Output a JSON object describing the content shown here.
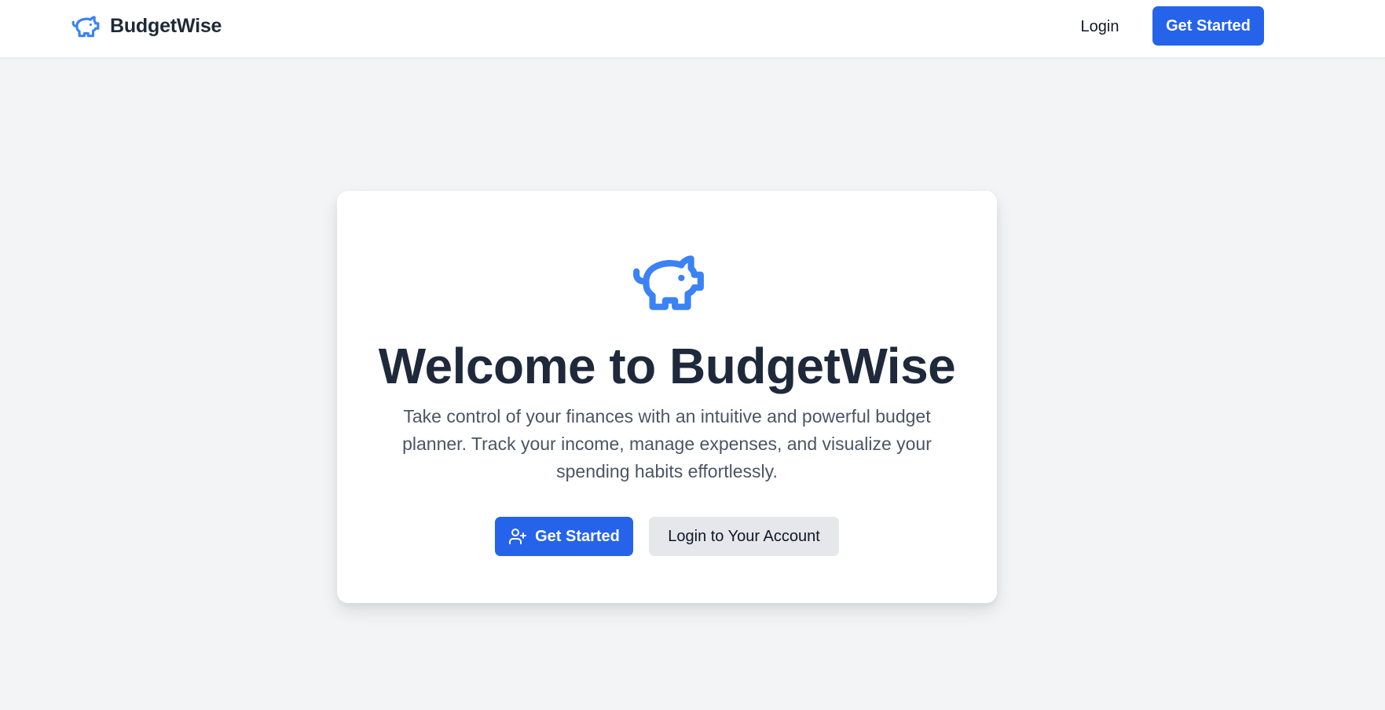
{
  "navbar": {
    "brand_icon": "piggy-bank-icon",
    "brand_name": "BudgetWise",
    "login_label": "Login",
    "get_started_label": "Get Started"
  },
  "hero": {
    "icon": "piggy-bank-icon",
    "title": "Welcome to BudgetWise",
    "subtitle": "Take control of your finances with an intuitive and powerful budget planner. Track your income, manage expenses, and visualize your spending habits effortlessly.",
    "primary_button": {
      "icon": "user-plus-icon",
      "label": "Get Started"
    },
    "secondary_button": {
      "label": "Login to Your Account"
    }
  },
  "colors": {
    "accent": "#2563eb",
    "icon": "#3b82f6",
    "background": "#f3f4f6",
    "card": "#ffffff",
    "title_text": "#1e293b",
    "body_text": "#4b5563",
    "secondary_button": "#e5e7eb"
  }
}
